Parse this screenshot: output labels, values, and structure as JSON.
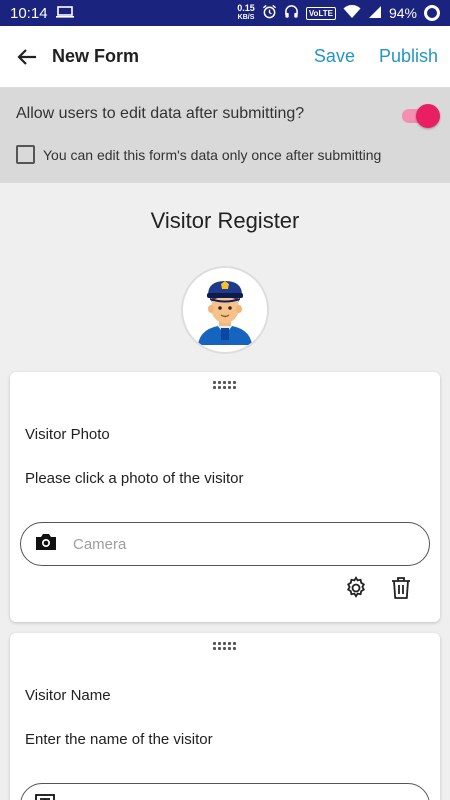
{
  "status_bar": {
    "time": "10:14",
    "net_speed_value": "0.15",
    "net_speed_unit": "KB/S",
    "volte": "VoLTE",
    "battery": "94%"
  },
  "app_bar": {
    "title": "New Form",
    "save_label": "Save",
    "publish_label": "Publish"
  },
  "settings": {
    "allow_edit_label": "Allow users to edit data after submitting?",
    "allow_edit_enabled": true,
    "edit_once_label": "You can edit this form's data only once after submitting",
    "edit_once_checked": false
  },
  "form": {
    "title": "Visitor Register",
    "avatar_icon": "police-officer-avatar",
    "fields": [
      {
        "title": "Visitor Photo",
        "description": "Please click a photo of the visitor",
        "input_icon": "camera-icon",
        "placeholder": "Camera"
      },
      {
        "title": "Visitor Name",
        "description": "Enter the name of the visitor",
        "input_icon": "text-field-icon"
      }
    ]
  },
  "colors": {
    "status_bar": "#1a237e",
    "accent_link": "#2196c9",
    "toggle_thumb": "#e91e63",
    "toggle_track": "#f48fb1",
    "settings_bg": "#d9d9d9",
    "page_bg": "#efefef"
  }
}
